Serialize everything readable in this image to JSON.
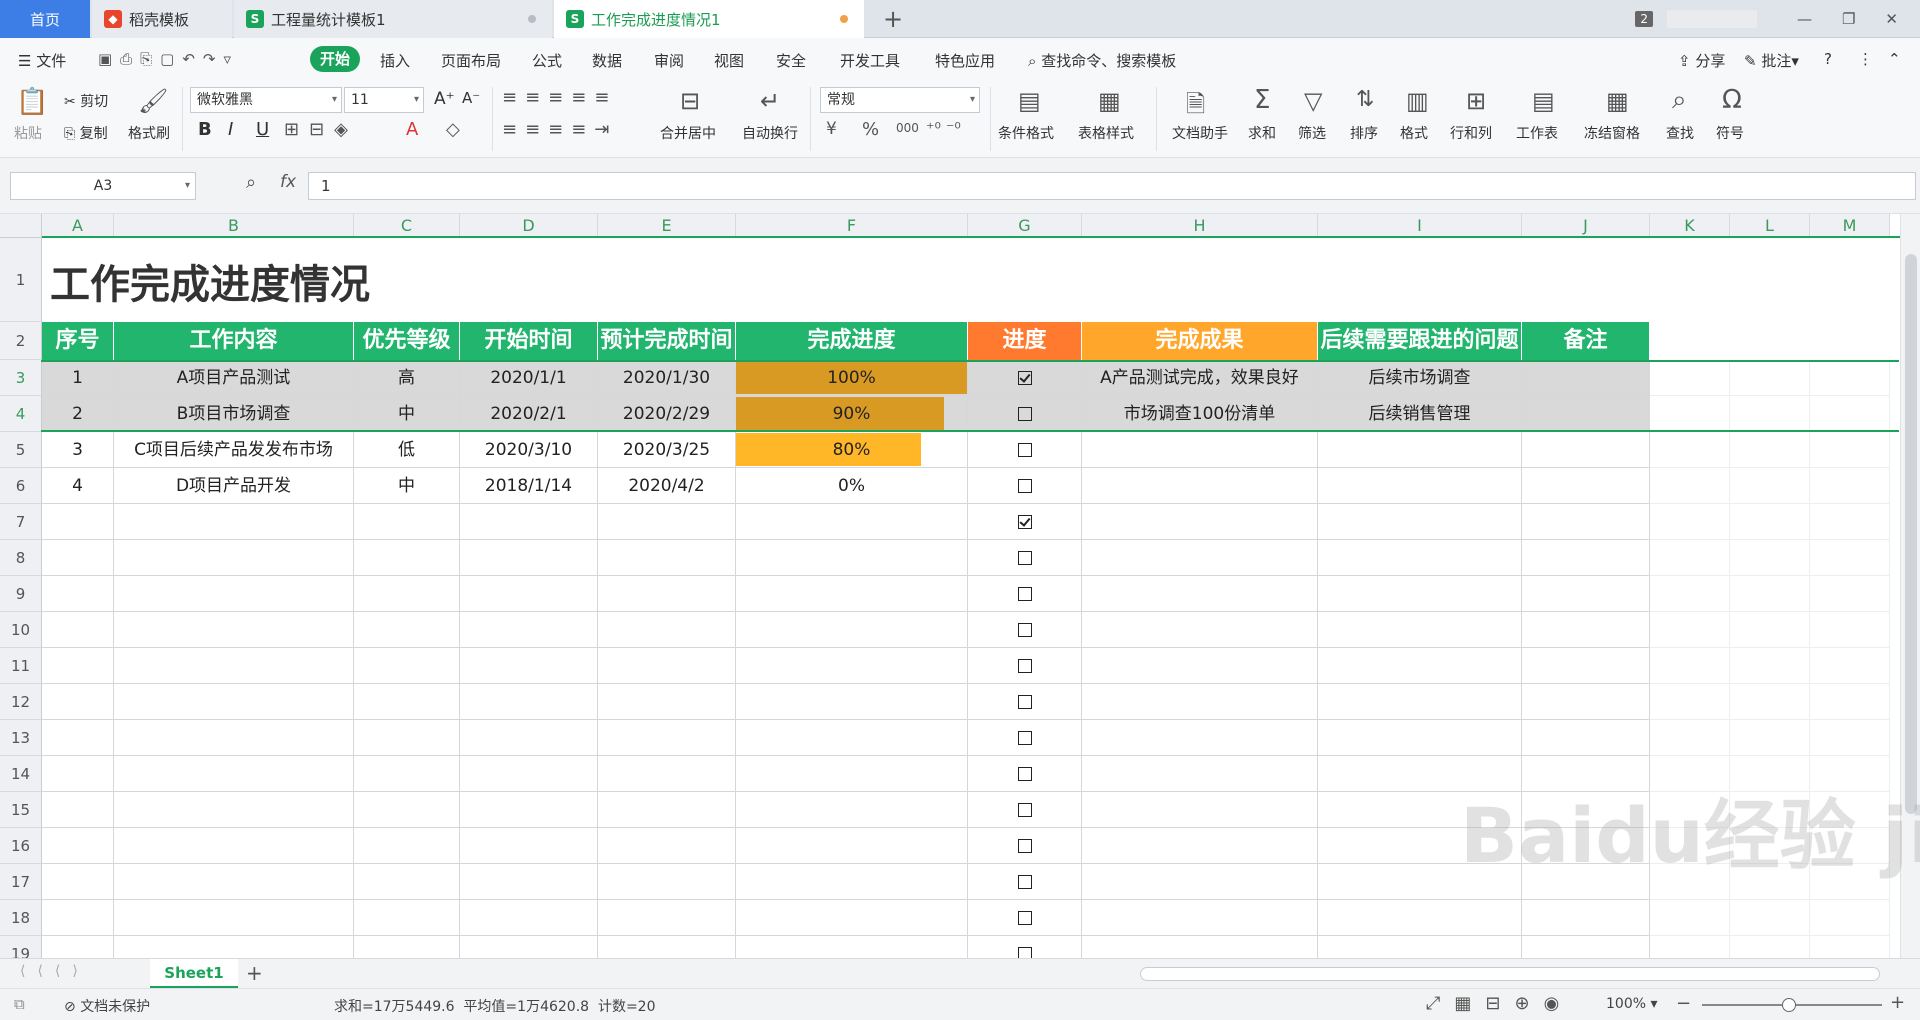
{
  "tabs": {
    "home": "首页",
    "docer": "稻壳模板",
    "t1": "工程量统计模板1",
    "t2": "工作完成进度情况1",
    "badge": "2"
  },
  "menu": {
    "file": "文件",
    "start": "开始",
    "items": [
      "插入",
      "页面布局",
      "公式",
      "数据",
      "审阅",
      "视图",
      "安全",
      "开发工具",
      "特色应用"
    ],
    "search": "查找命令、搜索模板",
    "share": "分享",
    "comment": "批注"
  },
  "ribbon": {
    "paste": "粘贴",
    "cut": "剪切",
    "copy": "复制",
    "format_painter": "格式刷",
    "font": "微软雅黑",
    "size": "11",
    "number_format": "常规",
    "merge": "合并居中",
    "wrap": "自动换行",
    "cond_format": "条件格式",
    "table_style": "表格样式",
    "doc_helper": "文档助手",
    "sum": "求和",
    "filter": "筛选",
    "sort": "排序",
    "format": "格式",
    "rowcol": "行和列",
    "worksheet": "工作表",
    "freeze": "冻结窗格",
    "find": "查找",
    "symbol": "符号",
    "bold": "B",
    "italic": "I",
    "underline": "U",
    "fontsize_up": "A⁺",
    "fontsize_down": "A⁻",
    "percent": "%",
    "thousands": "000"
  },
  "formula": {
    "name_box": "A3",
    "fx": "fx",
    "value": "1"
  },
  "columns": [
    "A",
    "B",
    "C",
    "D",
    "E",
    "F",
    "G",
    "H",
    "I",
    "J",
    "K",
    "L",
    "M"
  ],
  "title": "工作完成进度情况",
  "headers": [
    "序号",
    "工作内容",
    "优先等级",
    "开始时间",
    "预计完成时间",
    "完成进度",
    "进度",
    "完成成果",
    "后续需要跟进的问题",
    "备注"
  ],
  "rows": [
    {
      "no": "1",
      "task": "A项目产品测试",
      "priority": "高",
      "start": "2020/1/1",
      "end": "2020/1/30",
      "progress_label": "100%",
      "progress": 1.0,
      "done": true,
      "result": "A产品测试完成，效果良好",
      "follow": "后续市场调查",
      "note": ""
    },
    {
      "no": "2",
      "task": "B项目市场调查",
      "priority": "中",
      "start": "2020/2/1",
      "end": "2020/2/29",
      "progress_label": "90%",
      "progress": 0.9,
      "done": false,
      "result": "市场调查100份清单",
      "follow": "后续销售管理",
      "note": ""
    },
    {
      "no": "3",
      "task": "C项目后续产品发发布市场",
      "priority": "低",
      "start": "2020/3/10",
      "end": "2020/3/25",
      "progress_label": "80%",
      "progress": 0.8,
      "done": false,
      "result": "",
      "follow": "",
      "note": ""
    },
    {
      "no": "4",
      "task": "D项目产品开发",
      "priority": "中",
      "start": "2018/1/14",
      "end": "2020/4/2",
      "progress_label": "0%",
      "progress": 0.0,
      "done": false,
      "result": "",
      "follow": "",
      "note": ""
    }
  ],
  "extra_checks": [
    true,
    false,
    false,
    false,
    false,
    false,
    false,
    false,
    false,
    false,
    false,
    false,
    false
  ],
  "row_numbers": [
    "1",
    "2",
    "3",
    "4",
    "5",
    "6",
    "7",
    "8",
    "9",
    "10",
    "11",
    "12",
    "13",
    "14",
    "15",
    "16",
    "17",
    "18",
    "19"
  ],
  "sheet": {
    "name": "Sheet1",
    "add": "+"
  },
  "status": {
    "protect": "文档未保护",
    "stats": "求和=17万5449.6  平均值=1万4620.8  计数=20",
    "zoom": "100%"
  },
  "colors": {
    "accent": "#1aa35a",
    "header_green": "#21b56e",
    "header_orange": "#ff7a2e",
    "header_amber": "#ffa62b",
    "bar_full": "#d99a24",
    "bar_part": "#ffb627"
  },
  "watermark": "Baidu经验 jingyan.baidu.com"
}
